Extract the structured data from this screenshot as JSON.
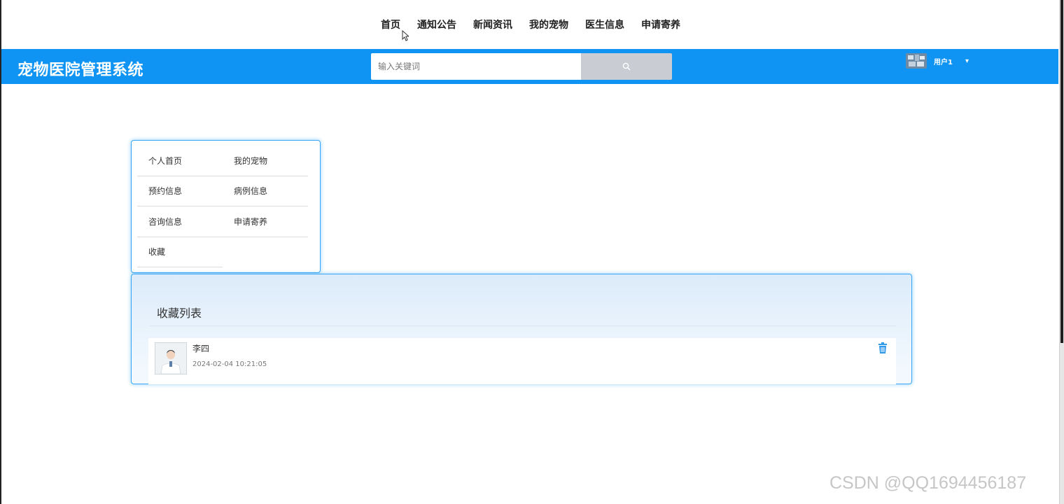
{
  "topnav": {
    "items": [
      "首页",
      "通知公告",
      "新闻资讯",
      "我的宠物",
      "医生信息",
      "申请寄养"
    ]
  },
  "header": {
    "brand": "宠物医院管理系统",
    "search": {
      "placeholder": "输入关键词",
      "value": "",
      "icon": "search-icon"
    },
    "user": {
      "name": "用户1",
      "caret": "▾",
      "avatar": "avatar-image"
    }
  },
  "side_menu": {
    "items": [
      "个人首页",
      "我的宠物",
      "预约信息",
      "病例信息",
      "咨询信息",
      "申请寄养",
      "收藏"
    ]
  },
  "favorites": {
    "title": "收藏列表",
    "items": [
      {
        "name": "李四",
        "time": "2024-02-04 10:21:05",
        "thumb": "doctor-photo",
        "action_icon": "trash-icon"
      }
    ]
  },
  "watermark": "CSDN @QQ1694456187",
  "colors": {
    "accent": "#0f94f4",
    "search_button": "#c9cdd3",
    "panel_border": "#39a6f5"
  }
}
